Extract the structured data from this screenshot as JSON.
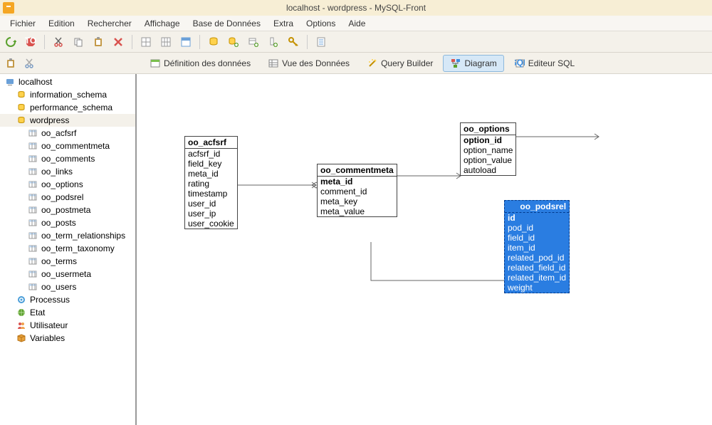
{
  "title": "localhost - wordpress - MySQL-Front",
  "menu": [
    "Fichier",
    "Edition",
    "Rechercher",
    "Affichage",
    "Base de Données",
    "Extra",
    "Options",
    "Aide"
  ],
  "tabs": {
    "def": "Définition des données",
    "vue": "Vue des Données",
    "query": "Query Builder",
    "diagram": "Diagram",
    "sql": "Editeur SQL"
  },
  "tree": {
    "host": "localhost",
    "schemas": [
      "information_schema",
      "performance_schema"
    ],
    "db": "wordpress",
    "tables": [
      "oo_acfsrf",
      "oo_commentmeta",
      "oo_comments",
      "oo_links",
      "oo_options",
      "oo_podsrel",
      "oo_postmeta",
      "oo_posts",
      "oo_term_relationships",
      "oo_term_taxonomy",
      "oo_terms",
      "oo_usermeta",
      "oo_users"
    ],
    "extras": [
      "Processus",
      "Etat",
      "Utilisateur",
      "Variables"
    ]
  },
  "erd": {
    "acfsrf": {
      "name": "oo_acfsrf",
      "cols": [
        "acfsrf_id",
        "field_key",
        "meta_id",
        "rating",
        "timestamp",
        "user_id",
        "user_ip",
        "user_cookie"
      ]
    },
    "commentmeta": {
      "name": "oo_commentmeta",
      "cols_bold": [
        "meta_id"
      ],
      "cols": [
        "comment_id",
        "meta_key",
        "meta_value"
      ]
    },
    "options": {
      "name": "oo_options",
      "cols_bold": [
        "option_id"
      ],
      "cols": [
        "option_name",
        "option_value",
        "autoload"
      ]
    },
    "podsrel": {
      "name": "oo_podsrel",
      "cols_bold": [
        "id"
      ],
      "cols": [
        "pod_id",
        "field_id",
        "item_id",
        "related_pod_id",
        "related_field_id",
        "related_item_id",
        "weight"
      ]
    }
  }
}
